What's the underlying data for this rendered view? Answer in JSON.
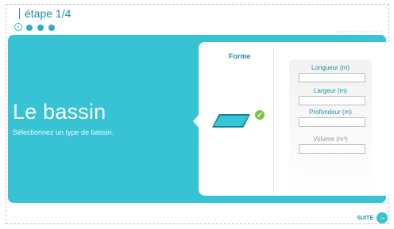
{
  "header": {
    "step_title": "étape 1/4",
    "steps": [
      {
        "active": true
      },
      {
        "active": false
      },
      {
        "active": false
      },
      {
        "active": false
      }
    ],
    "watermark": "Hayward Pool Europe 2012 | A"
  },
  "hero": {
    "title": "Le bassin",
    "subtitle": "Sélectionnez un type de bassin."
  },
  "form": {
    "forme_label": "Forme",
    "fields": [
      {
        "label": "Longueur (m)",
        "value": ""
      },
      {
        "label": "Largeur (m)",
        "value": ""
      },
      {
        "label": "Profondeur (m)",
        "value": ""
      },
      {
        "label": "Volume (m³)",
        "value": ""
      }
    ]
  },
  "footer": {
    "next_label": "SUITE"
  },
  "colors": {
    "accent": "#37c3d3",
    "accent_dark": "#1e8fa8",
    "confirm": "#7cc443"
  }
}
